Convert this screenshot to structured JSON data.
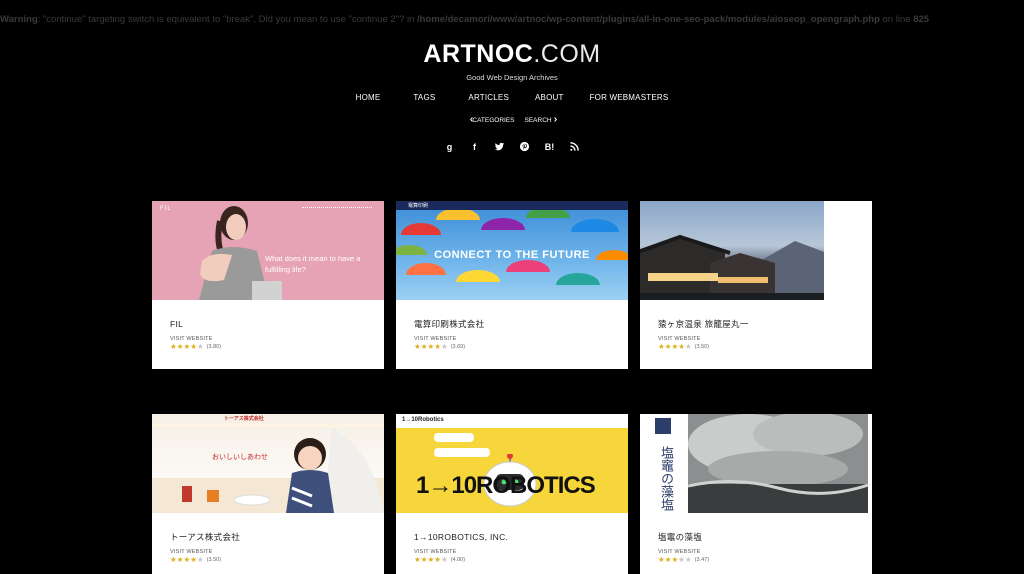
{
  "warning": {
    "prefix": "Warning",
    "message": ": \"continue\" targeting switch is equivalent to \"break\". Did you mean to use \"continue 2\"? in ",
    "path": "/home/decamori/www/artnoc/wp-content/plugins/all-in-one-seo-pack/modules/aioseop_opengraph.php",
    "line_text": " on line ",
    "line": "825"
  },
  "header": {
    "logo_bold": "ARTNOC",
    "logo_light": ".COM",
    "tagline": "Good Web Design Archives"
  },
  "nav": [
    "HOME",
    "TAGS",
    "ARTICLES",
    "ABOUT",
    "FOR WEBMASTERS"
  ],
  "subnav": {
    "categories": "CATEGORIES",
    "search": "SEARCH"
  },
  "social": [
    "google-plus",
    "facebook",
    "twitter",
    "pinterest",
    "hatena-bookmark",
    "rss"
  ],
  "social_glyphs": {
    "google-plus": "g",
    "facebook": "f",
    "hatena-bookmark": "B!"
  },
  "visit_label": "VISIT WEBSITE",
  "cards": [
    {
      "title": "FIL",
      "rating": 3.8,
      "score": "(3.80)",
      "thumb_text": "What does it mean to have a fulfilling life?",
      "thumb_logo": "FIL"
    },
    {
      "title": "電算印刷株式会社",
      "rating": 3.69,
      "score": "(3.69)",
      "thumb_text": "CONNECT TO THE FUTURE",
      "thumb_logo": "電算印刷"
    },
    {
      "title": "猿ヶ京温泉 旅籠屋丸一",
      "rating": 3.5,
      "score": "(3.50)"
    },
    {
      "title": "トーアス株式会社",
      "rating": 3.5,
      "score": "(3.50)",
      "thumb_logo": "トーアス株式会社",
      "thumb_text": "おいしいしあわせ"
    },
    {
      "title": "1→10ROBOTICS, INC.",
      "rating": 4.0,
      "score": "(4.00)",
      "thumb_logo": "1→10Robotics",
      "thumb_text": "1→10ROBOTICS"
    },
    {
      "title": "塩竈の藻塩",
      "rating": 3.47,
      "score": "(3.47)",
      "thumb_text": "塩竈の藻塩"
    }
  ],
  "colors": {
    "background": "#000000",
    "star_on": "#e0b020",
    "star_off": "#c8c8c8"
  }
}
